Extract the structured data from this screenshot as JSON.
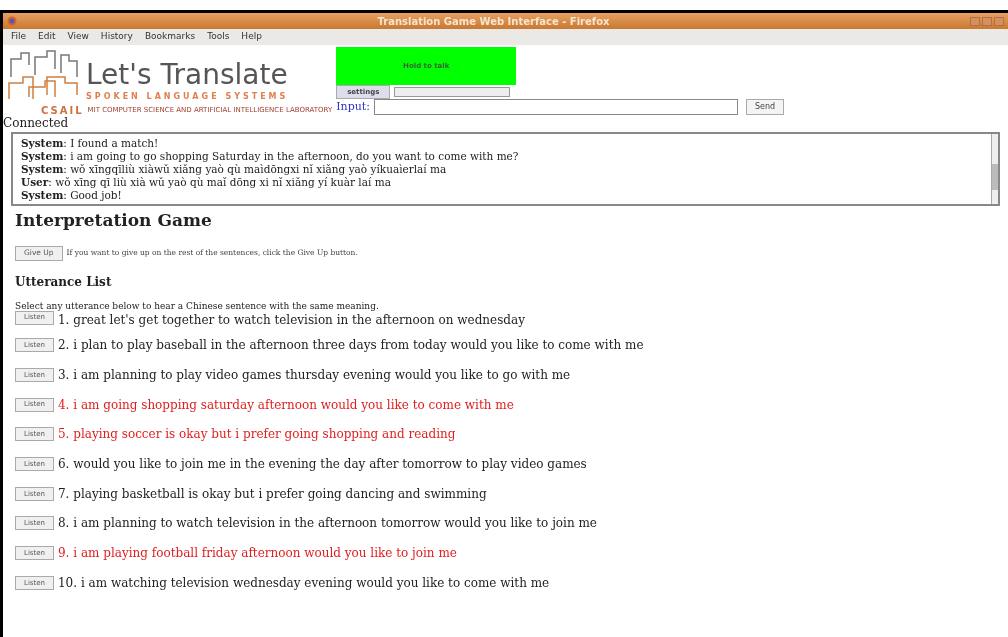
{
  "window": {
    "title": "Translation Game Web Interface - Firefox"
  },
  "menu": [
    "File",
    "Edit",
    "View",
    "History",
    "Bookmarks",
    "Tools",
    "Help"
  ],
  "header": {
    "logo_title": "Let's Translate",
    "logo_subtitle": "SPOKEN LANGUAGE SYSTEMS",
    "logo_org": "CSAIL",
    "logo_lab": "MIT COMPUTER SCIENCE AND ARTIFICIAL INTELLIGENCE LABORATORY",
    "talk_button": "Hold to talk",
    "settings_button": "settings",
    "input_label": "Input:",
    "send_button": "Send"
  },
  "status": "Connected",
  "log": [
    "**System**: I found a match!",
    "**System**: i am going to go shopping Saturday in the afternoon, do you want to come with me?",
    "**System**: wǒ xīngqīliù xiàwǔ xiǎng yaò qù maìdōngxi nǐ xiǎng yaò yíkuaìerlaí ma",
    "**User**: wǒ xīng qī liù xià wǔ yaò qù maǐ dōng xi nǐ xiǎng yí kuàr laí ma",
    "**System**: Good job!"
  ],
  "game": {
    "title": "Interpretation Game",
    "give_up_button": "Give Up",
    "give_up_hint": "If you want to give up on the rest of the sentences, click the Give Up button.",
    "list_title": "Utterance List",
    "list_hint": "Select any utterance below to hear a Chinese sentence with the same meaning."
  },
  "utterances": [
    {
      "button": "Listen",
      "text": "1. great let's get together to watch television in the afternoon on wednesday",
      "color": "#222222"
    },
    {
      "button": "Listen",
      "text": "2. i plan to play baseball in the afternoon three days from today would you like to come with me",
      "color": "#222222"
    },
    {
      "button": "Listen",
      "text": "3. i am planning to play video games thursday evening would you like to go with me",
      "color": "#222222"
    },
    {
      "button": "Listen",
      "text": "4. i am going shopping saturday afternoon would you like to come with me",
      "color": "#e02020"
    },
    {
      "button": "Listen",
      "text": "5. playing soccer is okay but i prefer going shopping and reading",
      "color": "#e02020"
    },
    {
      "button": "Listen",
      "text": "6. would you like to join me in the evening the day after tomorrow to play video games",
      "color": "#222222"
    },
    {
      "button": "Listen",
      "text": "7. playing basketball is okay but i prefer going dancing and swimming",
      "color": "#222222"
    },
    {
      "button": "Listen",
      "text": "8. i am planning to watch television in the afternoon tomorrow would you like to join me",
      "color": "#222222"
    },
    {
      "button": "Listen",
      "text": "9. i am playing football friday afternoon would you like to join me",
      "color": "#e02020"
    },
    {
      "button": "Listen",
      "text": "10. i am watching television wednesday evening would you like to come with me",
      "color": "#222222"
    }
  ]
}
